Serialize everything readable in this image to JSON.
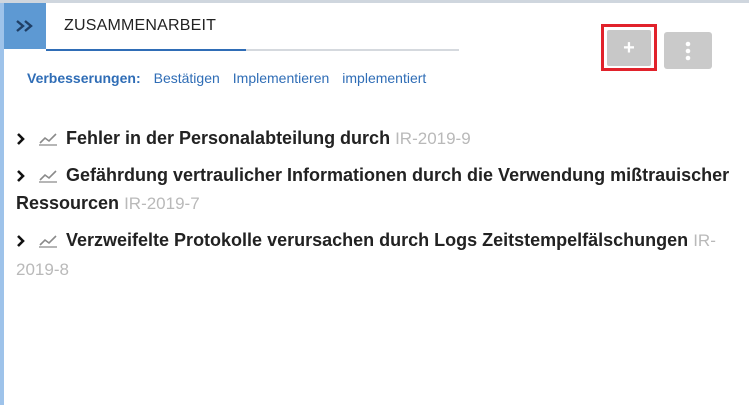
{
  "header": {
    "tab_title": "ZUSAMMENARBEIT",
    "expand_icon": "double-chevron-right-icon"
  },
  "toolbar": {
    "add_label": "+",
    "more_icon": "vertical-ellipsis-icon"
  },
  "filters": {
    "label": "Verbesserungen:",
    "links": [
      "Bestätigen",
      "Implementieren",
      "implementiert"
    ]
  },
  "items": [
    {
      "title": "Fehler in der Personalabteilung durch",
      "id": "IR-2019-9"
    },
    {
      "title": "Gefährdung vertraulicher Informationen durch die Verwendung mißtrauischer Ressourcen",
      "id": "IR-2019-7"
    },
    {
      "title": "Verzweifelte Protokolle verursachen durch Logs Zeitstempelfälschungen",
      "id": "IR-2019-8"
    }
  ],
  "colors": {
    "accent": "#2f6db6",
    "expand_bg": "#5d99d3",
    "highlight": "#e1222b",
    "muted_id": "#b9b9b9"
  }
}
